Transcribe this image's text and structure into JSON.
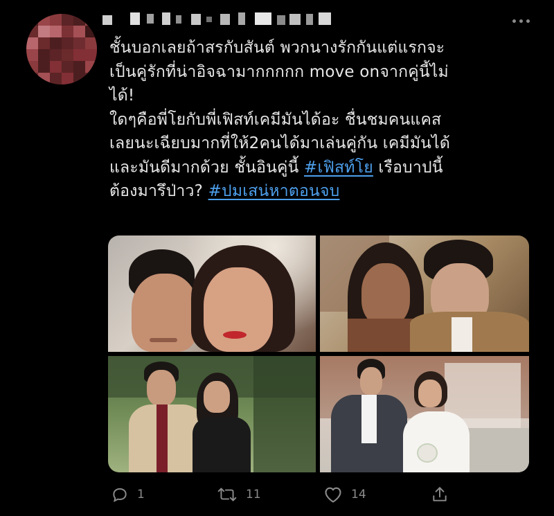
{
  "tweet": {
    "text_lines": [
      "ชั้นบอกเลยถ้าสรกับสันต์ พวกนางรักกันแต่แรกจะ",
      "เป็นคู่รักที่น่าอิจฉามากกกกก move onจากคู่นี้ไม่",
      "ได้!",
      "ใดๆคือพี่โยกับพี่เฟิสท์เคมีมันได้อะ ชื่นชมคนแคส",
      "เลยนะเฉียบมากที่ให้2คนได้มาเล่นคู่กัน เคมีมันได้",
      "และมันดีมากด้วย ชั้นอินคู่นี้ ",
      "ต้องมารึป่าว? "
    ],
    "hashtag_1": "#เฟิสท์โย",
    "after_hashtag_1": " เรือบาปนี้",
    "hashtag_2": "#ปมเสน่หาตอนจบ",
    "link_color": "#4d9fec"
  },
  "actions": {
    "reply_icon": "reply-icon",
    "reply_count": "1",
    "retweet_icon": "retweet-icon",
    "retweet_count": "11",
    "like_icon": "heart-icon",
    "like_count": "14",
    "share_icon": "share-icon"
  },
  "menu": {
    "icon": "more-icon"
  }
}
